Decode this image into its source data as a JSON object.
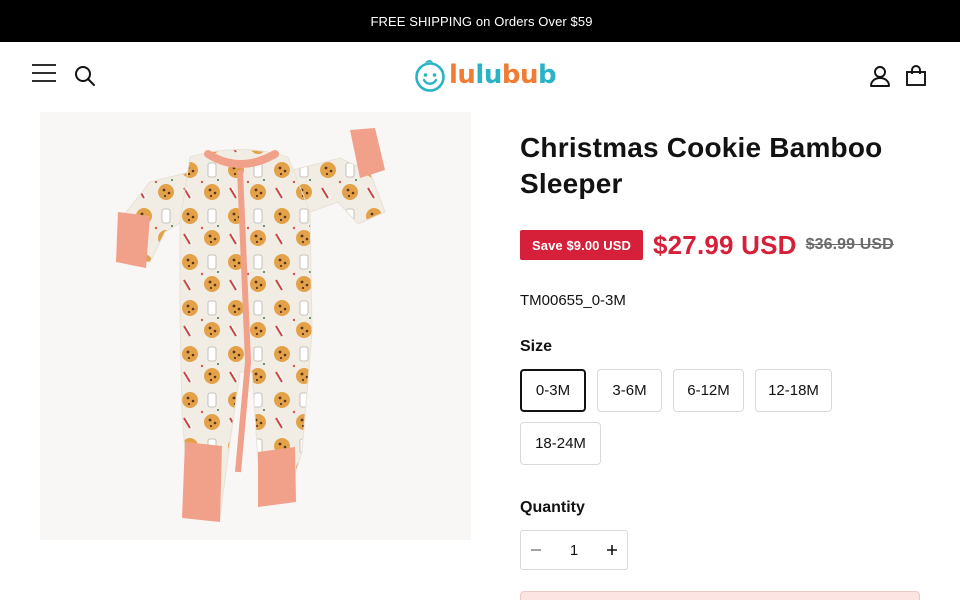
{
  "announcement": {
    "glyph": "",
    "text": "FREE SHIPPING on Orders Over $59"
  },
  "header": {
    "logo_text": [
      "lu",
      "lu",
      "bu",
      "b"
    ],
    "icons": {
      "menu": "menu-icon",
      "search": "search-icon",
      "account": "account-icon",
      "cart": "cart-icon"
    }
  },
  "product": {
    "title": "Christmas Cookie Bamboo Sleeper",
    "save_badge": "Save $9.00 USD",
    "price": "$27.99 USD",
    "compare_price": "$36.99 USD",
    "sku": "TM00655_0-3M",
    "size_label": "Size",
    "sizes": [
      "0-3M",
      "3-6M",
      "6-12M",
      "12-18M",
      "18-24M"
    ],
    "selected_size": "0-3M",
    "quantity_label": "Quantity",
    "quantity_value": "1",
    "image_alt": "Christmas cookie print bamboo zip sleeper with peach cuffs"
  },
  "colors": {
    "sale_red": "#d6203a",
    "brand_orange": "#ef7d35",
    "brand_teal": "#2ab3c6",
    "accent_peach": "#f1a08a"
  }
}
